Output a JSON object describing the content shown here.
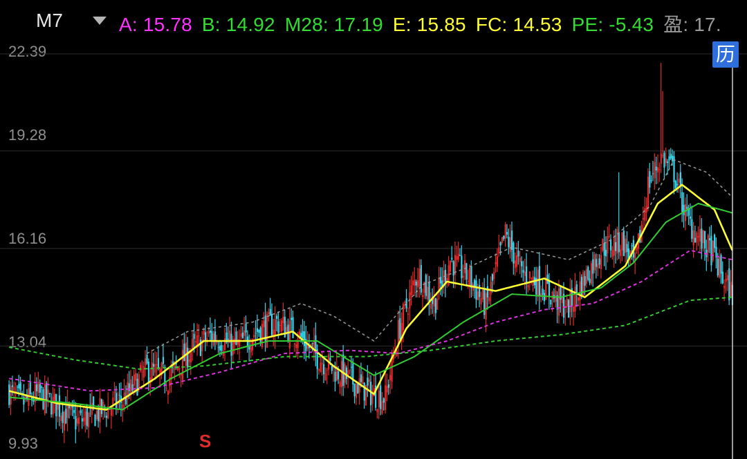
{
  "header": {
    "symbol": "M7",
    "dropdown_icon": "triangle-down-icon",
    "indicators": [
      {
        "key": "A",
        "value": "15.78",
        "color": "#ff33ff"
      },
      {
        "key": "B",
        "value": "14.92",
        "color": "#33dd33"
      },
      {
        "key": "M28",
        "value": "17.19",
        "color": "#33dd33"
      },
      {
        "key": "E",
        "value": "15.85",
        "color": "#ffff33"
      },
      {
        "key": "FC",
        "value": "14.53",
        "color": "#ffff33"
      },
      {
        "key": "PE",
        "value": "-5.43",
        "color": "#33dd33"
      },
      {
        "key": "盈",
        "value": "17.",
        "color": "#9a9a9a"
      }
    ]
  },
  "history_button_label": "历",
  "signal_marker": "S",
  "chart_data": {
    "type": "candlestick",
    "ylim": [
      9.93,
      22.39
    ],
    "y_ticks": [
      "22.39",
      "19.28",
      "16.16",
      "13.04",
      "9.93"
    ],
    "grid": true,
    "colors": {
      "up": "#e42a2a",
      "down": "#36d8ef",
      "ma_yellow": "#ffff33",
      "ma_green": "#33cc33",
      "ma_magenta": "#dd33dd",
      "ma_green_dashed": "#33cc33",
      "ma_gray_dashed": "#9a9a9a",
      "ma_orange": "#ff8c1a"
    },
    "close_path_keypoints": [
      [
        0,
        11.6
      ],
      [
        8,
        11.2
      ],
      [
        18,
        11.5
      ],
      [
        30,
        11.1
      ],
      [
        42,
        10.6
      ],
      [
        55,
        10.9
      ],
      [
        70,
        11.3
      ],
      [
        85,
        12.3
      ],
      [
        98,
        12.0
      ],
      [
        112,
        12.9
      ],
      [
        125,
        13.4
      ],
      [
        140,
        13.0
      ],
      [
        152,
        13.5
      ],
      [
        165,
        13.8
      ],
      [
        178,
        13.4
      ],
      [
        190,
        12.7
      ],
      [
        200,
        12.3
      ],
      [
        212,
        11.9
      ],
      [
        224,
        11.5
      ],
      [
        232,
        11.4
      ],
      [
        240,
        13.5
      ],
      [
        252,
        15.4
      ],
      [
        262,
        14.4
      ],
      [
        272,
        15.8
      ],
      [
        284,
        15.2
      ],
      [
        294,
        14.3
      ],
      [
        306,
        16.6
      ],
      [
        316,
        15.4
      ],
      [
        326,
        15.1
      ],
      [
        336,
        14.6
      ],
      [
        344,
        14.2
      ],
      [
        356,
        15.3
      ],
      [
        366,
        16.2
      ],
      [
        378,
        16.4
      ],
      [
        386,
        15.6
      ],
      [
        394,
        18.2
      ],
      [
        402,
        19.1
      ],
      [
        410,
        18.6
      ],
      [
        418,
        17.1
      ],
      [
        428,
        16.3
      ],
      [
        434,
        16.0
      ],
      [
        440,
        15.2
      ],
      [
        446,
        14.7
      ]
    ],
    "ma_series": [
      {
        "key": "yellow",
        "kps": [
          [
            0,
            11.6
          ],
          [
            30,
            11.2
          ],
          [
            60,
            11.0
          ],
          [
            90,
            12.0
          ],
          [
            120,
            13.2
          ],
          [
            150,
            13.2
          ],
          [
            175,
            13.5
          ],
          [
            200,
            12.4
          ],
          [
            225,
            11.5
          ],
          [
            245,
            13.6
          ],
          [
            270,
            15.1
          ],
          [
            300,
            14.8
          ],
          [
            330,
            15.2
          ],
          [
            355,
            14.6
          ],
          [
            380,
            15.6
          ],
          [
            400,
            17.6
          ],
          [
            415,
            18.2
          ],
          [
            435,
            17.4
          ],
          [
            446,
            16.1
          ]
        ]
      },
      {
        "key": "green",
        "kps": [
          [
            0,
            11.4
          ],
          [
            40,
            11.2
          ],
          [
            70,
            11.0
          ],
          [
            100,
            12.0
          ],
          [
            130,
            12.8
          ],
          [
            160,
            13.2
          ],
          [
            190,
            13.2
          ],
          [
            225,
            12.1
          ],
          [
            250,
            12.7
          ],
          [
            280,
            13.8
          ],
          [
            310,
            14.7
          ],
          [
            340,
            14.6
          ],
          [
            365,
            14.9
          ],
          [
            385,
            15.7
          ],
          [
            405,
            17.0
          ],
          [
            425,
            17.6
          ],
          [
            446,
            17.3
          ]
        ]
      },
      {
        "key": "magenta",
        "kps": [
          [
            0,
            12.0
          ],
          [
            50,
            11.6
          ],
          [
            90,
            11.7
          ],
          [
            130,
            12.2
          ],
          [
            170,
            12.8
          ],
          [
            210,
            12.9
          ],
          [
            240,
            12.8
          ],
          [
            270,
            13.2
          ],
          [
            300,
            13.8
          ],
          [
            330,
            14.2
          ],
          [
            360,
            14.4
          ],
          [
            390,
            15.1
          ],
          [
            420,
            16.1
          ],
          [
            446,
            15.8
          ]
        ]
      },
      {
        "key": "green_dashed",
        "kps": [
          [
            0,
            13.0
          ],
          [
            40,
            12.6
          ],
          [
            80,
            12.3
          ],
          [
            120,
            12.4
          ],
          [
            170,
            12.7
          ],
          [
            220,
            12.7
          ],
          [
            260,
            12.9
          ],
          [
            300,
            13.2
          ],
          [
            340,
            13.4
          ],
          [
            380,
            13.7
          ],
          [
            420,
            14.5
          ],
          [
            446,
            14.6
          ]
        ]
      },
      {
        "key": "gray_dashed",
        "kps": [
          [
            85,
            12.8
          ],
          [
            110,
            13.5
          ],
          [
            150,
            13.8
          ],
          [
            180,
            14.4
          ],
          [
            200,
            14.0
          ],
          [
            225,
            13.2
          ],
          [
            255,
            15.0
          ],
          [
            285,
            15.6
          ],
          [
            310,
            16.2
          ],
          [
            345,
            15.8
          ],
          [
            370,
            16.4
          ],
          [
            395,
            17.5
          ],
          [
            410,
            19.0
          ],
          [
            430,
            18.6
          ],
          [
            446,
            17.8
          ]
        ]
      }
    ]
  }
}
